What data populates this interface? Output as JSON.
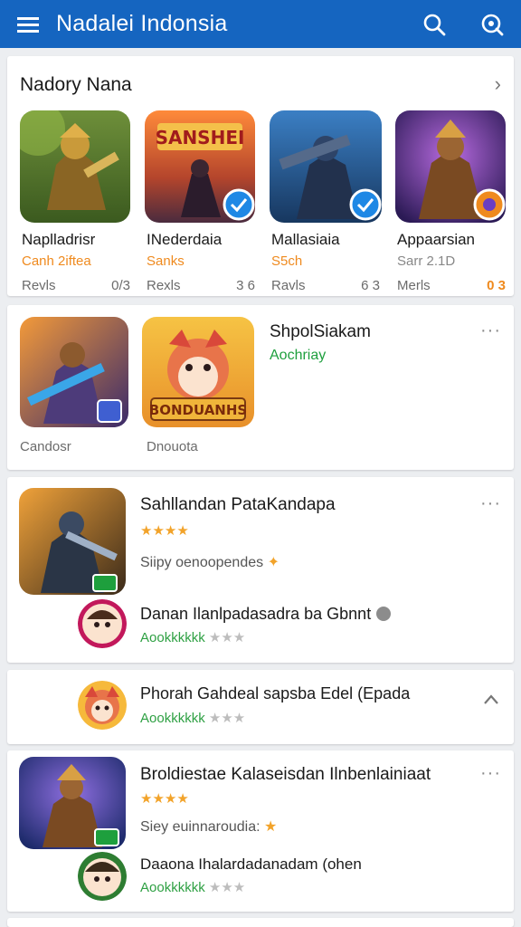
{
  "appbar": {
    "title": "Nadalei Indonsia",
    "menu_icon": "menu-icon",
    "search_icon": "search-icon",
    "search_alt_icon": "search-icon"
  },
  "section1": {
    "title": "Nadory Nana",
    "arrow": "›",
    "apps": [
      {
        "name": "Naplladrisr",
        "sub": "Canh 2iftea",
        "reviews": "Revls",
        "count": "0/3"
      },
      {
        "name": "INederdaia",
        "sub": "Sanks",
        "reviews": "Rexls",
        "count": "3 6"
      },
      {
        "name": "Mallasiaia",
        "sub": "S5ch",
        "reviews": "Ravls",
        "count": "6 3"
      },
      {
        "name": "Appaarsian",
        "sub": "Sarr 2.1D",
        "reviews": "Merls",
        "count": "0 3"
      }
    ]
  },
  "section2": {
    "title": "ShpolSiakam",
    "subtitle": "Aochriay",
    "app1_label": "Candosr",
    "app2_label": "Dnouota",
    "thumb_banner": "BONDUANHS",
    "more": "···"
  },
  "section3": {
    "title": "Sahllandan PataKandapa",
    "stars": "★★★★",
    "desc": "Siipy oenoopendes",
    "sub_title": "Danan Ilanlpadasadra ba Gbnnt",
    "sub_rating": "Aookkkkkk",
    "sub_stars_off": "★★★",
    "more": "···"
  },
  "section4": {
    "title": "Phorah Gahdeal sapsba Edel (Epada",
    "rating": "Aookkkkkk",
    "stars_off": "★★★",
    "arrow": "‹"
  },
  "section5": {
    "title": "Broldiestae Kalaseisdan Ilnbenlainiaat",
    "stars": "★★★★",
    "desc": "Siey euinnaroudia:",
    "sub_title": "Daaona Ihalardadanadam (ohen",
    "sub_rating": "Aookkkkkk",
    "sub_stars_off": "★★★",
    "more": "···"
  },
  "colors": {
    "appbar": "#1565c0",
    "accent_orange": "#ef8a1e",
    "accent_green": "#1e9f3d"
  }
}
